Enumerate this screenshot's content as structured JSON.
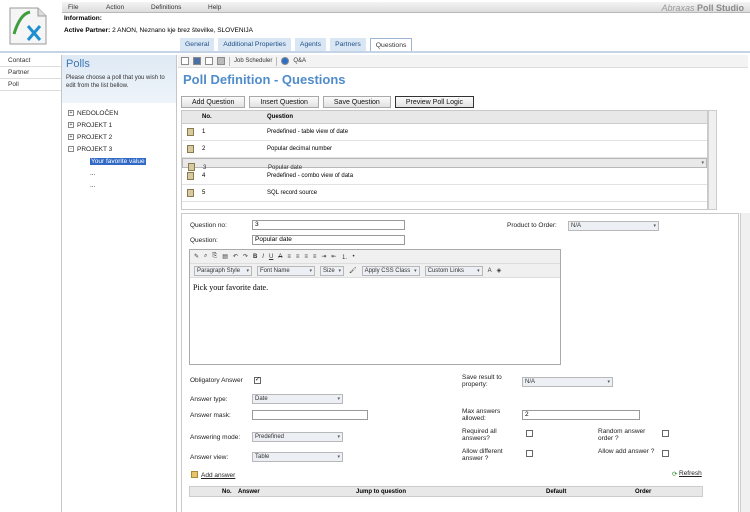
{
  "app": {
    "brand_prefix": "Abraxas",
    "brand_name": "Poll Studio"
  },
  "menu": [
    "File",
    "Action",
    "Definitions",
    "Help"
  ],
  "info": {
    "label": "Information:",
    "partner_label": "Active Partner:",
    "partner_value": "2 ANON, Neznano kje brez številke, SLOVENIJA"
  },
  "tabs": [
    "General",
    "Additional Properties",
    "Agents",
    "Partners",
    "Questions"
  ],
  "leftnav": [
    "Contact",
    "Partner",
    "Poll"
  ],
  "polls": {
    "title": "Polls",
    "description": "Please choose a poll that you wish to edit from the list bellow."
  },
  "tree": [
    {
      "label": "NEDOLOČEN",
      "exp": "+"
    },
    {
      "label": "PROJEKT 1",
      "exp": "+"
    },
    {
      "label": "PROJEKT 2",
      "exp": "+"
    },
    {
      "label": "PROJEKT 3",
      "exp": "-"
    }
  ],
  "tree_children": [
    "Your favorite value",
    "...",
    "..."
  ],
  "toolbar": {
    "job_scheduler": "Job Scheduler",
    "qa": "Q&A"
  },
  "page_title": "Poll Definition - Questions",
  "buttons": [
    "Add Question",
    "Insert Question",
    "Save Question",
    "Preview Poll Logic"
  ],
  "question_table": {
    "headers": [
      "No.",
      "Question"
    ],
    "rows": [
      {
        "no": "1",
        "q": "Predefined - table view of date"
      },
      {
        "no": "2",
        "q": "Popular decimal number"
      },
      {
        "no": "3",
        "q": "Popular date"
      },
      {
        "no": "4",
        "q": "Predefined - combo view of data"
      },
      {
        "no": "5",
        "q": "SQL record source"
      }
    ]
  },
  "form": {
    "question_no_label": "Question no:",
    "question_no": "3",
    "question_label": "Question:",
    "question": "Popular date",
    "product_label": "Product to Order:",
    "product": "N/A",
    "editor_tb2": [
      "Paragraph Style",
      "Font Name",
      "Size",
      "Apply CSS Class",
      "Custom Links"
    ],
    "editor_text": "Pick your favorite date.",
    "obligatory_label": "Obligatory Answer",
    "obligatory_check": "✓",
    "save_result_label": "Save result to property:",
    "save_result": "N/A",
    "answer_type_label": "Answer type:",
    "answer_type": "Date",
    "answer_mask_label": "Answer mask:",
    "answer_mask": "",
    "max_answers_label": "Max answers allowed:",
    "max_answers": "2",
    "answering_mode_label": "Answering mode:",
    "answering_mode": "Predefined",
    "required_all_label": "Required all answers?",
    "random_order_label": "Random answer order ?",
    "answer_view_label": "Answer view:",
    "answer_view": "Table",
    "allow_diff_label": "Allow different answer ?",
    "allow_add_label": "Allow add answer ?",
    "add_answer": "Add answer",
    "refresh": "Refresh"
  },
  "answer_table": {
    "headers": [
      "No.",
      "Answer",
      "Jump to question",
      "Default",
      "Order"
    ]
  },
  "colors": {
    "accent": "#4f8cc9",
    "tab_bg": "#d9e6f3",
    "selection": "#3169c6"
  }
}
